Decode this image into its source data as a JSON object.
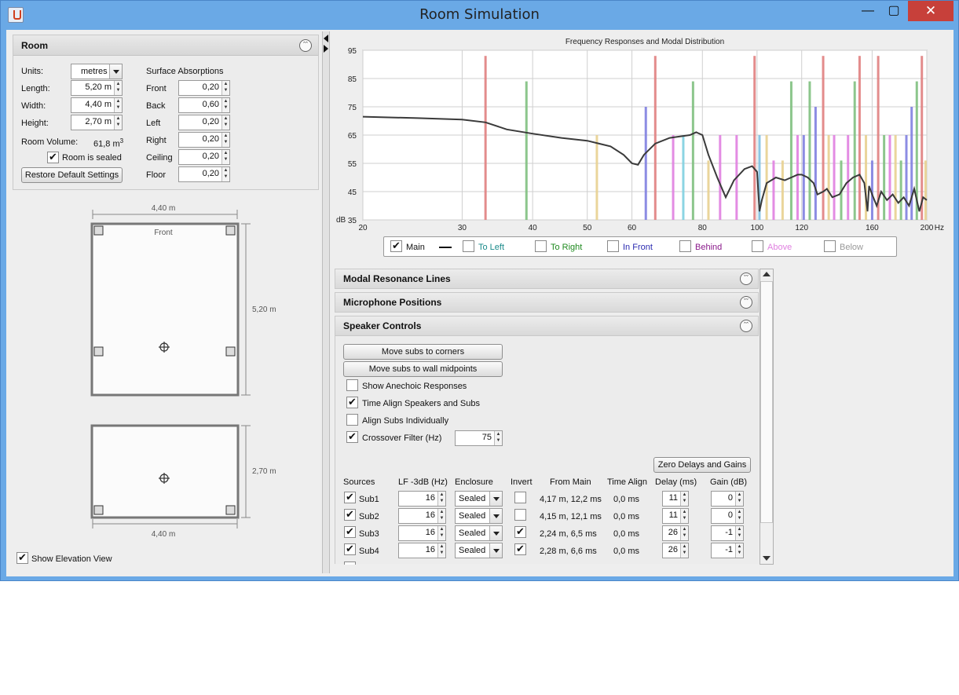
{
  "window": {
    "title": "Room Simulation",
    "minimize": "—",
    "maximize": "▢",
    "close": "✕"
  },
  "room_panel": {
    "title": "Room",
    "units_label": "Units:",
    "units_value": "metres",
    "length_label": "Length:",
    "length_value": "5,20 m",
    "width_label": "Width:",
    "width_value": "4,40 m",
    "height_label": "Height:",
    "height_value": "2,70 m",
    "volume_label": "Room Volume:",
    "volume_value": "61,8 m",
    "volume_sup": "3",
    "sealed_label": "Room is sealed",
    "sealed_checked": true,
    "restore_button": "Restore Default Settings",
    "absorptions_title": "Surface Absorptions",
    "absorptions": [
      {
        "label": "Front",
        "value": "0,20"
      },
      {
        "label": "Back",
        "value": "0,60"
      },
      {
        "label": "Left",
        "value": "0,20"
      },
      {
        "label": "Right",
        "value": "0,20"
      },
      {
        "label": "Ceiling",
        "value": "0,20"
      },
      {
        "label": "Floor",
        "value": "0,20"
      }
    ]
  },
  "plan_view": {
    "width_label": "4,40 m",
    "depth_label": "5,20 m",
    "front_label": "Front"
  },
  "elevation_view": {
    "height_label": "2,70 m",
    "width_label": "4,40 m"
  },
  "show_elevation": {
    "label": "Show Elevation View",
    "checked": true
  },
  "chart_data": {
    "type": "line",
    "title": "Frequency Responses and Modal Distribution",
    "ylabel": "dB",
    "xunit": "Hz",
    "xscale": "log",
    "xlim": [
      20,
      200
    ],
    "ylim": [
      35,
      95
    ],
    "x_ticks": [
      "20",
      "30",
      "40",
      "50",
      "60",
      "80",
      "100",
      "120",
      "160",
      "200"
    ],
    "y_ticks": [
      "35",
      "45",
      "55",
      "65",
      "75",
      "85",
      "95"
    ],
    "series": [
      {
        "name": "Main",
        "color": "#3a3a3a",
        "x": [
          20,
          25,
          30,
          33,
          36,
          40,
          45,
          50,
          55,
          58,
          60,
          61.5,
          63,
          66,
          70,
          73,
          76,
          78,
          80,
          82,
          85,
          88,
          91,
          95,
          98,
          100,
          101,
          102,
          104,
          108,
          112,
          115,
          118,
          120,
          123,
          126,
          128,
          131,
          133,
          136,
          140,
          144,
          148,
          152,
          155,
          157,
          158,
          160,
          163,
          166,
          170,
          174,
          178,
          182,
          186,
          190,
          194,
          197,
          200
        ],
        "y": [
          71.5,
          71,
          70.5,
          69.5,
          67,
          65.5,
          64,
          63,
          61,
          58,
          55,
          54.5,
          58,
          62,
          64,
          64.5,
          65,
          66,
          65,
          58,
          50,
          43,
          49,
          53,
          54,
          52,
          38,
          42,
          48,
          50,
          49,
          50,
          51,
          51,
          50,
          48,
          44,
          45,
          46,
          43,
          44,
          48,
          50,
          51,
          48,
          38,
          47,
          44,
          40,
          45,
          42,
          44,
          41,
          43,
          40,
          46,
          38,
          43,
          42
        ]
      }
    ],
    "modal_lines": [
      {
        "f": 33.0,
        "h": 93,
        "c": "#e08080"
      },
      {
        "f": 39.0,
        "h": 84,
        "c": "#80c080"
      },
      {
        "f": 52.0,
        "h": 65,
        "c": "#e8d090"
      },
      {
        "f": 63.5,
        "h": 75,
        "c": "#8080e0"
      },
      {
        "f": 66.0,
        "h": 93,
        "c": "#e08080"
      },
      {
        "f": 71.0,
        "h": 65,
        "c": "#e080e0"
      },
      {
        "f": 74.0,
        "h": 65,
        "c": "#80d0e0"
      },
      {
        "f": 77.0,
        "h": 84,
        "c": "#80c080"
      },
      {
        "f": 82.0,
        "h": 56,
        "c": "#e8d090"
      },
      {
        "f": 86.0,
        "h": 65,
        "c": "#e080e0"
      },
      {
        "f": 92.0,
        "h": 65,
        "c": "#e080e0"
      },
      {
        "f": 99.0,
        "h": 93,
        "c": "#e08080"
      },
      {
        "f": 101.0,
        "h": 65,
        "c": "#80c0e0"
      },
      {
        "f": 104.0,
        "h": 65,
        "c": "#e8d090"
      },
      {
        "f": 107.0,
        "h": 56,
        "c": "#e080e0"
      },
      {
        "f": 111.0,
        "h": 56,
        "c": "#e8d090"
      },
      {
        "f": 115.0,
        "h": 84,
        "c": "#80c080"
      },
      {
        "f": 118.0,
        "h": 65,
        "c": "#e080e0"
      },
      {
        "f": 121.0,
        "h": 65,
        "c": "#8080e0"
      },
      {
        "f": 124.0,
        "h": 84,
        "c": "#80c080"
      },
      {
        "f": 127.0,
        "h": 75,
        "c": "#8080e0"
      },
      {
        "f": 131.0,
        "h": 93,
        "c": "#e08080"
      },
      {
        "f": 134.0,
        "h": 65,
        "c": "#e8d090"
      },
      {
        "f": 137.0,
        "h": 65,
        "c": "#e080e0"
      },
      {
        "f": 141.0,
        "h": 56,
        "c": "#80c080"
      },
      {
        "f": 145.0,
        "h": 65,
        "c": "#e080e0"
      },
      {
        "f": 149.0,
        "h": 84,
        "c": "#80c080"
      },
      {
        "f": 152.0,
        "h": 93,
        "c": "#e08080"
      },
      {
        "f": 156.0,
        "h": 65,
        "c": "#e8d090"
      },
      {
        "f": 160.0,
        "h": 56,
        "c": "#8080e0"
      },
      {
        "f": 164.0,
        "h": 93,
        "c": "#e08080"
      },
      {
        "f": 168.0,
        "h": 65,
        "c": "#80c080"
      },
      {
        "f": 172.0,
        "h": 65,
        "c": "#e080e0"
      },
      {
        "f": 176.0,
        "h": 65,
        "c": "#e8d090"
      },
      {
        "f": 180.0,
        "h": 56,
        "c": "#80c080"
      },
      {
        "f": 184.0,
        "h": 65,
        "c": "#8080e0"
      },
      {
        "f": 188.0,
        "h": 75,
        "c": "#8080e0"
      },
      {
        "f": 192.0,
        "h": 84,
        "c": "#80c080"
      },
      {
        "f": 196.0,
        "h": 93,
        "c": "#e08080"
      },
      {
        "f": 199.0,
        "h": 56,
        "c": "#e8d090"
      }
    ],
    "legend": [
      {
        "label": "Main",
        "checked": true,
        "color": "#111111"
      },
      {
        "label": "To Left",
        "checked": false,
        "color": "#1a8a8a"
      },
      {
        "label": "To Right",
        "checked": false,
        "color": "#1f8a1f"
      },
      {
        "label": "In Front",
        "checked": false,
        "color": "#2a2ab0"
      },
      {
        "label": "Behind",
        "checked": false,
        "color": "#8a1a8a"
      },
      {
        "label": "Above",
        "checked": false,
        "color": "#e080e0"
      },
      {
        "label": "Below",
        "checked": false,
        "color": "#999999"
      }
    ]
  },
  "accordions": {
    "modal": "Modal Resonance Lines",
    "mic": "Microphone Positions",
    "speaker": "Speaker Controls"
  },
  "speaker_controls": {
    "move_corners": "Move subs to corners",
    "move_midpoints": "Move subs to wall midpoints",
    "show_anechoic": {
      "label": "Show Anechoic Responses",
      "checked": false
    },
    "time_align": {
      "label": "Time Align Speakers and Subs",
      "checked": true
    },
    "align_individually": {
      "label": "Align Subs Individually",
      "checked": false
    },
    "crossover": {
      "label": "Crossover Filter (Hz)",
      "checked": true,
      "value": "75"
    },
    "zero_button": "Zero Delays and Gains",
    "headers": [
      "Sources",
      "LF -3dB (Hz)",
      "Enclosure",
      "Invert",
      "From Main",
      "Time Align",
      "Delay (ms)",
      "Gain (dB)"
    ],
    "rows": [
      {
        "name": "Sub1",
        "checked": true,
        "lf": "16",
        "enclosure": "Sealed",
        "invert": false,
        "from_main": "4,17 m, 12,2 ms",
        "time_align": "0,0 ms",
        "delay": "11",
        "gain": "0"
      },
      {
        "name": "Sub2",
        "checked": true,
        "lf": "16",
        "enclosure": "Sealed",
        "invert": false,
        "from_main": "4,15 m, 12,1 ms",
        "time_align": "0,0 ms",
        "delay": "11",
        "gain": "0"
      },
      {
        "name": "Sub3",
        "checked": true,
        "lf": "16",
        "enclosure": "Sealed",
        "invert": true,
        "from_main": "2,24 m, 6,5 ms",
        "time_align": "0,0 ms",
        "delay": "26",
        "gain": "-1"
      },
      {
        "name": "Sub4",
        "checked": true,
        "lf": "16",
        "enclosure": "Sealed",
        "invert": true,
        "from_main": "2,28 m, 6,6 ms",
        "time_align": "0,0 ms",
        "delay": "26",
        "gain": "-1"
      }
    ]
  }
}
